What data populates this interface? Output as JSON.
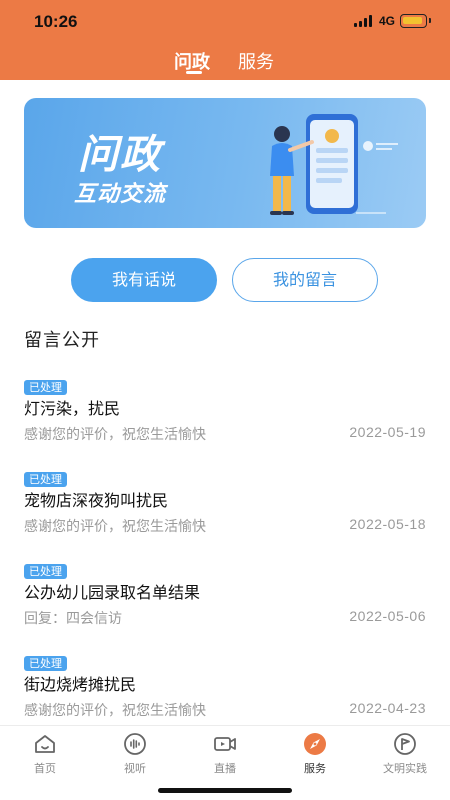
{
  "status_bar": {
    "time": "10:26",
    "network": "4G"
  },
  "top_tabs": [
    {
      "label": "问政",
      "active": true
    },
    {
      "label": "服务",
      "active": false
    }
  ],
  "banner": {
    "title": "问政",
    "subtitle": "互动交流"
  },
  "buttons": {
    "speak": "我有话说",
    "my_messages": "我的留言"
  },
  "section_title": "留言公开",
  "messages": [
    {
      "badge": "已处理",
      "title": "灯污染，扰民",
      "summary": "感谢您的评价，祝您生活愉快",
      "date": "2022-05-19"
    },
    {
      "badge": "已处理",
      "title": "宠物店深夜狗叫扰民",
      "summary": "感谢您的评价，祝您生活愉快",
      "date": "2022-05-18"
    },
    {
      "badge": "已处理",
      "title": "公办幼儿园录取名单结果",
      "summary": "回复：四会信访",
      "date": "2022-05-06"
    },
    {
      "badge": "已处理",
      "title": "街边烧烤摊扰民",
      "summary": "感谢您的评价，祝您生活愉快",
      "date": "2022-04-23"
    }
  ],
  "bottom_nav": [
    {
      "label": "首页",
      "icon": "home-icon",
      "active": false
    },
    {
      "label": "视听",
      "icon": "audio-icon",
      "active": false
    },
    {
      "label": "直播",
      "icon": "live-video-icon",
      "active": false
    },
    {
      "label": "服务",
      "icon": "compass-icon",
      "active": true
    },
    {
      "label": "文明实践",
      "icon": "flag-icon",
      "active": false
    }
  ],
  "colors": {
    "header": "#ec7a45",
    "accent_blue": "#4ba3ee",
    "active_nav": "#ec7a45"
  }
}
